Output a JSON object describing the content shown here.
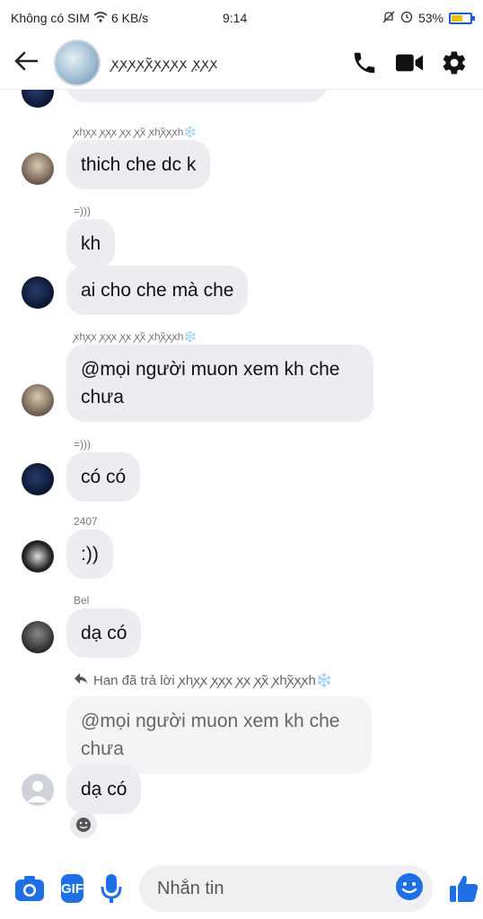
{
  "status": {
    "carrier": "Không có SIM",
    "speed": "6 KB/s",
    "time": "9:14",
    "battery": "53%",
    "battery_level": 0.53
  },
  "header": {
    "title": "ꭗꭗꭗꭗꭗ̃ꭗꭗꭗꭗ ꭗ̣ꭗꭗ"
  },
  "messages": [
    {
      "sender": "ꭗhꭗꭗ ꭗꭗꭗ ꭗꭗ ꭗꭗ̃ ꭗhꭗ̃ꭗꭗh❄️",
      "text": "thich che dc k"
    },
    {
      "sender": "=)))",
      "text": "kh"
    },
    {
      "text": "ai cho che mà che"
    },
    {
      "sender": "ꭗhꭗꭗ ꭗꭗꭗ ꭗꭗ ꭗꭗ̃ ꭗhꭗ̃ꭗꭗh❄️",
      "text": "@mọi người muon xem kh che chưa"
    },
    {
      "sender": "=)))",
      "text": "có có"
    },
    {
      "sender": "2407",
      "text": ":))"
    },
    {
      "sender": "Bel",
      "text": "dạ có"
    }
  ],
  "reply": {
    "label": "Han đã trả lời ꭗhꭗꭗ ꭗꭗꭗ ꭗꭗ ꭗꭗ̃ ꭗhꭗ̃ꭗꭗh❄️",
    "quoted": "@mọi người muon xem kh che chưa",
    "text": "dạ có"
  },
  "composer": {
    "gif_label": "GIF",
    "placeholder": "Nhắn tin"
  },
  "colors": {
    "accent": "#1f6fe5",
    "bubble": "#ececf1"
  }
}
